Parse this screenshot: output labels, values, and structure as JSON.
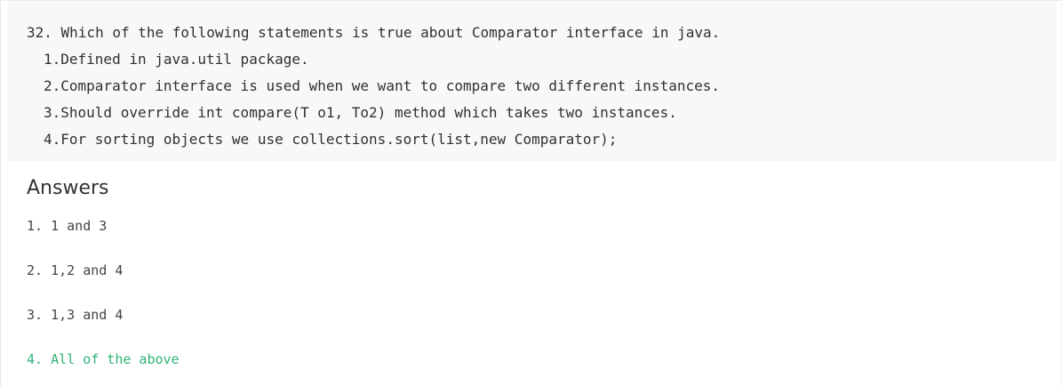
{
  "question": {
    "stem": "32. Which of the following statements is true about Comparator interface in java.",
    "statements": [
      "1.Defined in java.util package.",
      "2.Comparator interface is used when we want to compare two different instances.",
      "3.Should override int compare(T o1, To2) method which takes two instances.",
      "4.For sorting objects we use collections.sort(list,new Comparator);"
    ]
  },
  "answers": {
    "heading": "Answers",
    "options": [
      {
        "label": "1. 1 and 3",
        "correct": false
      },
      {
        "label": "2. 1,2 and 4",
        "correct": false
      },
      {
        "label": "3. 1,3 and 4",
        "correct": false
      },
      {
        "label": "4. All of the above",
        "correct": true
      }
    ],
    "correct_color": "#2fb376"
  }
}
